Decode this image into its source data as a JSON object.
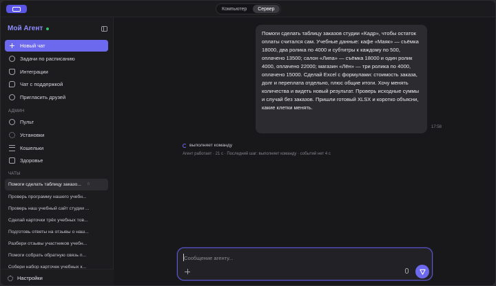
{
  "topbar": {
    "tabs": [
      {
        "label": "Компьютер",
        "active": false
      },
      {
        "label": "Сервер",
        "active": true
      }
    ]
  },
  "sidebar": {
    "brand": "Мой Агент",
    "primary_items": [
      {
        "label": "Новый чат",
        "icon": "plus-icon"
      },
      {
        "label": "Задачи по расписанию",
        "icon": "clock-icon"
      },
      {
        "label": "Интеграции",
        "icon": "plug-icon"
      },
      {
        "label": "Чат с поддержкой",
        "icon": "chat-icon"
      },
      {
        "label": "Пригласить друзей",
        "icon": "invite-icon"
      }
    ],
    "admin_label": "АДМИН",
    "admin_items": [
      {
        "label": "Пульт",
        "icon": "dashboard-icon"
      },
      {
        "label": "Установки",
        "icon": "gear-icon"
      },
      {
        "label": "Кошельки",
        "icon": "wallet-icon"
      },
      {
        "label": "Здоровье",
        "icon": "health-icon"
      }
    ],
    "chats_label": "ЧАТЫ",
    "chats": [
      "Помоги сделать таблицу заказо...",
      "Проверь программу нашего учебн...",
      "Проверь наш учебный сайт студии ...",
      "Сделай карточки трёх учебных тов...",
      "Подготовь ответы на отзывы о наш...",
      "Разбери отзывы участников учебн...",
      "Помоги собрать обратную связь п...",
      "Собери набор карточек учебных к..."
    ],
    "settings_label": "Настройки"
  },
  "main": {
    "message": "Помоги сделать таблицу заказов студии «Кадр», чтобы остаток оплаты считался сам. Учебные данные: кафе «Маяк» — съёмка 18000, два ролика по 4000 и субтитры к каждому по 500, оплачено 13500; салон «Липа» — съёмка 18000 и один ролик 4000, оплачено 22000; магазин «Лён» — три ролика по 4000, оплачено 15000. Сделай Excel с формулами: стоимость заказа, долг и переплата отдельно, плюс общие итоги. Хочу менять количества и видеть новый результат. Проверь исходные суммы и случай без заказов. Пришли готовый XLSX и коротко объясни, какие клетки менять.",
    "message_time": "17:58",
    "status": "выполняет команду",
    "status_detail": "Агент работает · 21 с · Последний шаг: выполняет команду · событий нет 4 с",
    "composer_placeholder": "Сообщение агенту..."
  },
  "colors": {
    "accent": "#6d69ee",
    "brand": "#8f8cff",
    "online": "#31c46b",
    "background": "#18181b",
    "sidebar": "#1c1c1f",
    "bubble": "#2b2b30"
  }
}
